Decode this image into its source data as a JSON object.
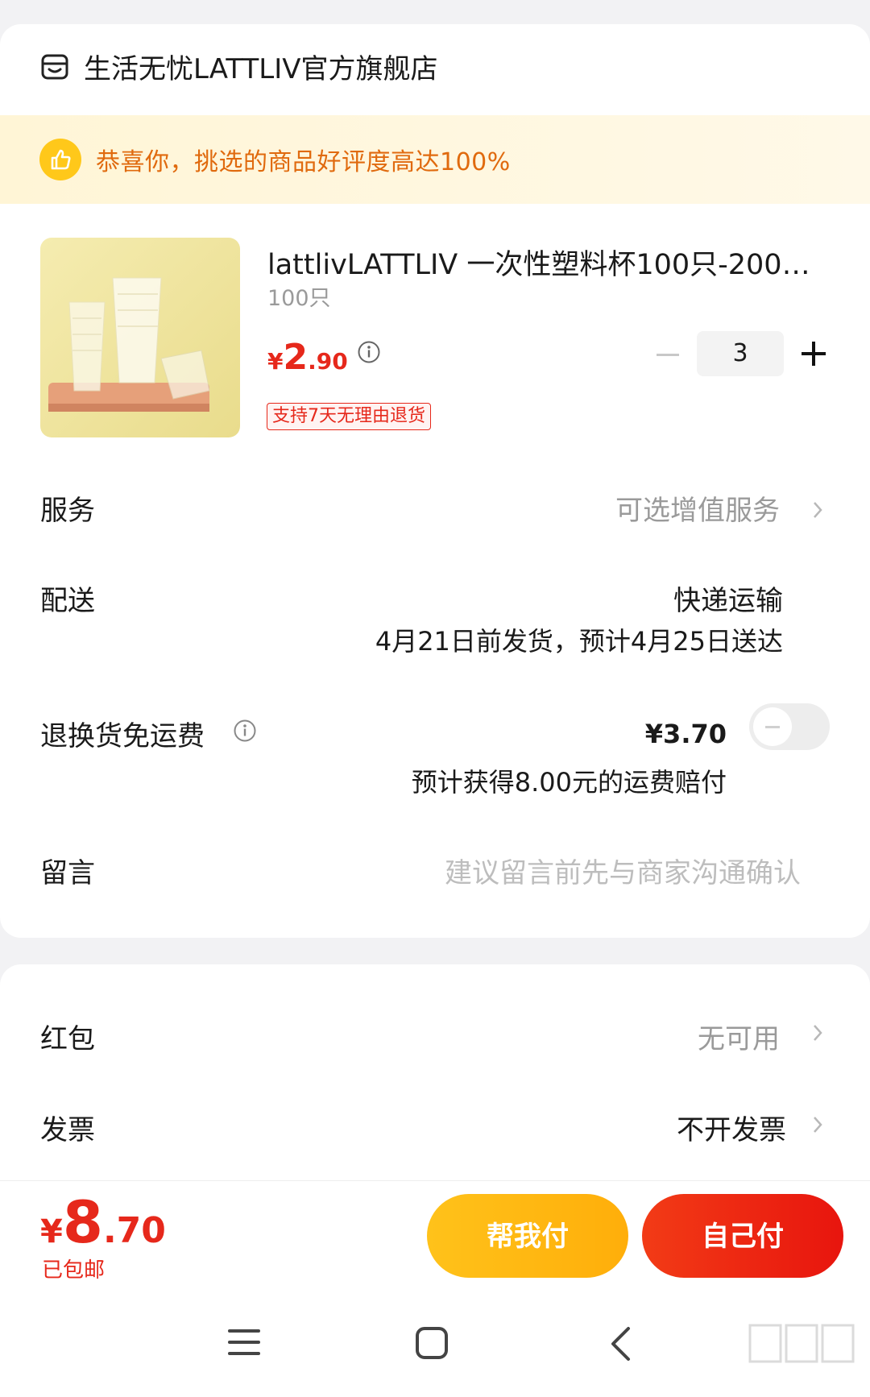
{
  "store": {
    "name": "生活无忧LATTLIV官方旗舰店",
    "icon": "store-icon"
  },
  "banner": {
    "text": "恭喜你，挑选的商品好评度高达100%",
    "icon": "thumbs-up-icon"
  },
  "product": {
    "title": "lattlivLATTLIV 一次性塑料杯100只-200m...",
    "spec": "100只",
    "price_symbol": "¥",
    "price_int": "2",
    "price_dec": ".90",
    "return_tag": "支持7天无理由退货",
    "quantity": "3"
  },
  "rows": {
    "service": {
      "label": "服务",
      "value": "可选增值服务"
    },
    "delivery": {
      "label": "配送",
      "method": "快递运输",
      "eta": "4月21日前发货，预计4月25日送达"
    },
    "return_shipping": {
      "label": "退换货免运费",
      "price": "¥3.70",
      "note": "预计获得8.00元的运费赔付",
      "enabled": false
    },
    "message": {
      "label": "留言",
      "placeholder": "建议留言前先与商家沟通确认"
    },
    "red_packet": {
      "label": "红包",
      "value": "无可用"
    },
    "invoice": {
      "label": "发票",
      "value": "不开发票"
    }
  },
  "footer": {
    "total_symbol": "¥",
    "total_int": "8",
    "total_dec": ".70",
    "shipping": "已包邮",
    "help_pay": "帮我付",
    "self_pay": "自己付"
  },
  "colors": {
    "accent_red": "#e6281b",
    "banner_orange": "#e06a0e",
    "help_yellow": "#ffb812"
  }
}
